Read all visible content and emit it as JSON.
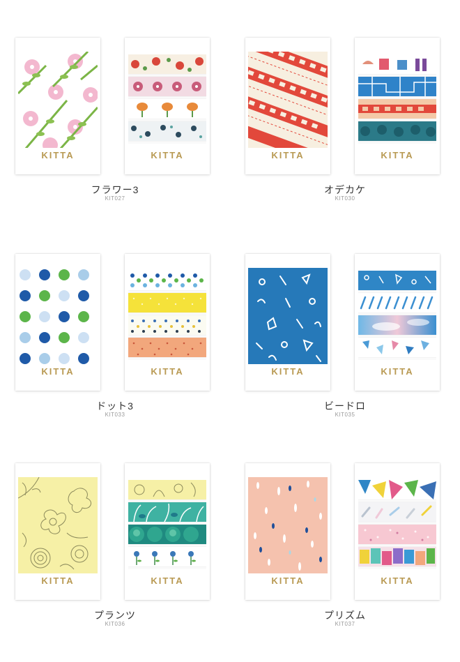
{
  "colors": {
    "brand_gold": "#b99a53",
    "label_text": "#333333",
    "code_text": "#9a9a9a"
  },
  "products": [
    {
      "name": "フラワー3",
      "code": "KIT027",
      "brand": "KITTA"
    },
    {
      "name": "オデカケ",
      "code": "KIT030",
      "brand": "KITTA"
    },
    {
      "name": "ドット3",
      "code": "KIT033",
      "brand": "KITTA"
    },
    {
      "name": "ビードロ",
      "code": "KIT035",
      "brand": "KITTA"
    },
    {
      "name": "プランツ",
      "code": "KIT036",
      "brand": "KITTA"
    },
    {
      "name": "プリズム",
      "code": "KIT037",
      "brand": "KITTA"
    }
  ]
}
